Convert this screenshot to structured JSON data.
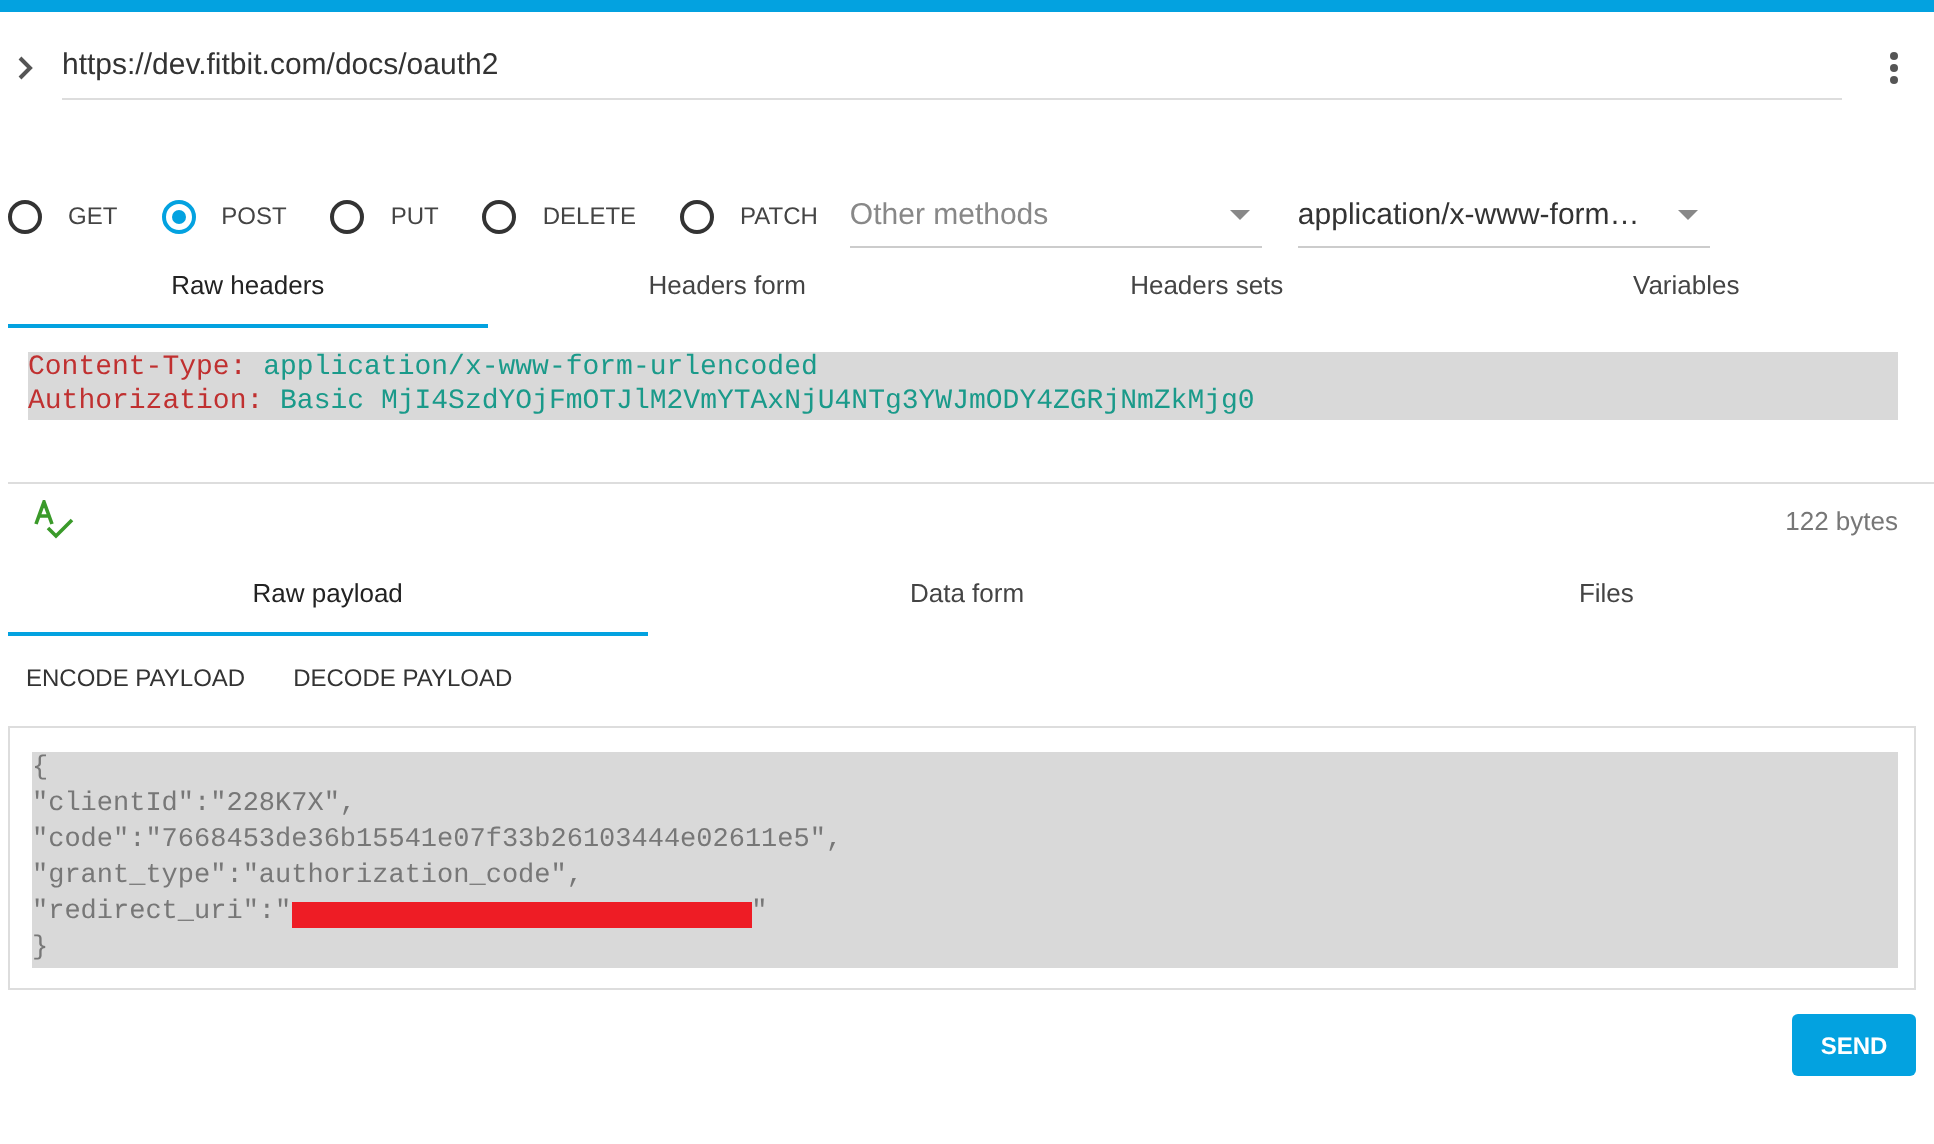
{
  "url": "https://dev.fitbit.com/docs/oauth2",
  "methods": [
    {
      "label": "GET",
      "selected": false
    },
    {
      "label": "POST",
      "selected": true
    },
    {
      "label": "PUT",
      "selected": false
    },
    {
      "label": "DELETE",
      "selected": false
    },
    {
      "label": "PATCH",
      "selected": false
    }
  ],
  "other_methods": {
    "placeholder": "Other methods"
  },
  "content_type": "application/x-www-form…",
  "header_tabs": [
    {
      "label": "Raw headers",
      "selected": true
    },
    {
      "label": "Headers form",
      "selected": false
    },
    {
      "label": "Headers sets",
      "selected": false
    },
    {
      "label": "Variables",
      "selected": false
    }
  ],
  "headers": [
    {
      "name": "Content-Type:",
      "value": "application/x-www-form-urlencoded"
    },
    {
      "name": "Authorization:",
      "value": "Basic MjI4SzdYOjFmOTJlM2VmYTAxNjU4NTg3YWJmODY4ZGRjNmZkMjg0"
    }
  ],
  "size": "122 bytes",
  "payload_tabs": [
    {
      "label": "Raw payload",
      "selected": true
    },
    {
      "label": "Data form",
      "selected": false
    },
    {
      "label": "Files",
      "selected": false
    }
  ],
  "payload_actions": [
    "ENCODE PAYLOAD",
    "DECODE PAYLOAD"
  ],
  "payload_lines": [
    {
      "text": "{",
      "redacted": false
    },
    {
      "text": "\"clientId\":\"228K7X\",",
      "redacted": false
    },
    {
      "text": "\"code\":\"7668453de36b15541e07f33b26103444e02611e5\",",
      "redacted": false
    },
    {
      "text": "\"grant_type\":\"authorization_code\",",
      "redacted": false
    },
    {
      "text": "\"redirect_uri\":\"",
      "redacted": true,
      "tail": "\""
    },
    {
      "text": "}",
      "redacted": false
    }
  ],
  "send_button": "SEND"
}
